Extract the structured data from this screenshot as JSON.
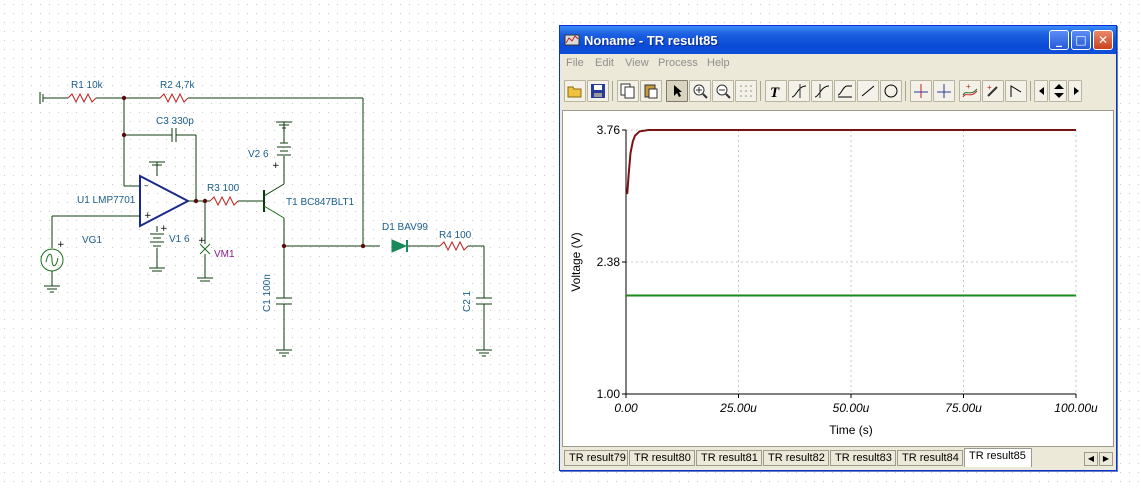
{
  "schematic": {
    "labels": {
      "r1": "R1 10k",
      "r2": "R2 4,7k",
      "c3": "C3 330p",
      "v2": "V2 6",
      "u1": "U1 LMP7701",
      "r3": "R3 100",
      "t1": "T1 BC847BLT1",
      "vg1": "VG1",
      "v1": "V1 6",
      "vm1": "VM1",
      "d1": "D1 BAV99",
      "r4": "R4 100",
      "c1": "C1 100n",
      "c2": "C2 1"
    }
  },
  "window": {
    "title": "Noname - TR result85",
    "menu": [
      "File",
      "Edit",
      "View",
      "Process",
      "Help"
    ],
    "toolbar_icons": [
      "open-folder-icon",
      "save-icon",
      "copy-icon",
      "paste-icon",
      "pointer-icon",
      "zoom-in-icon",
      "zoom-out-icon",
      "grid-icon",
      "text-tool-icon",
      "cursor-a-icon",
      "cursor-b-icon",
      "curve-icon",
      "line-icon",
      "circle-icon",
      "marker-a-icon",
      "marker-b-icon",
      "add-curve-icon",
      "probe-icon",
      "flag-icon",
      "nav-left-icon",
      "nav-updown-icon",
      "nav-right-icon"
    ]
  },
  "chart_data": {
    "type": "line",
    "xlabel": "Time (s)",
    "ylabel": "Voltage (V)",
    "xlim": [
      0,
      0.0001
    ],
    "ylim": [
      1.0,
      3.76
    ],
    "x_ticks": [
      "0.00",
      "25.00u",
      "50.00u",
      "75.00u",
      "100.00u"
    ],
    "y_ticks": [
      "3.76",
      "2.38",
      "1.00"
    ],
    "grid": true,
    "series": [
      {
        "color": "#7a1212",
        "x": [
          0,
          3e-07,
          6e-07,
          1e-06,
          1.5e-06,
          2e-06,
          3e-06,
          5e-06,
          1e-05,
          5e-05,
          0.0001
        ],
        "y": [
          3.1,
          3.1,
          3.3,
          3.52,
          3.64,
          3.7,
          3.745,
          3.76,
          3.76,
          3.76,
          3.76
        ]
      },
      {
        "color": "#1a8a1a",
        "x": [
          0,
          0.0001
        ],
        "y": [
          2.03,
          2.03
        ]
      }
    ]
  },
  "tabs": [
    "TR result79",
    "TR result80",
    "TR result81",
    "TR result82",
    "TR result83",
    "TR result84",
    "TR result85"
  ],
  "active_tab": "TR result85"
}
